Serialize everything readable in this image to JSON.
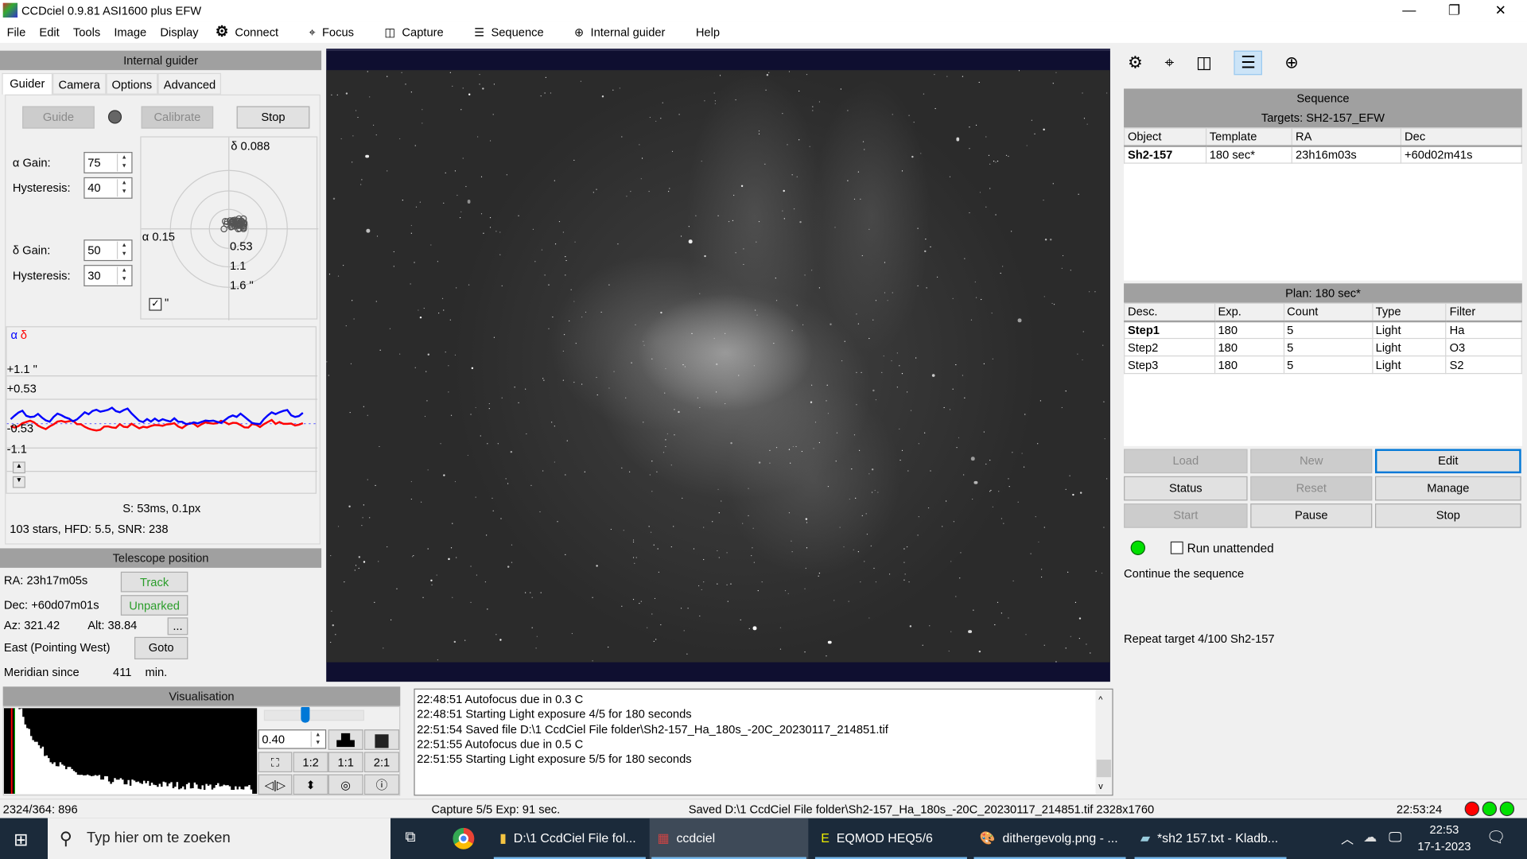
{
  "window": {
    "title": "CCDciel 0.9.81 ASI1600 plus EFW",
    "min": "—",
    "max": "❐",
    "close": "✕"
  },
  "menu": {
    "items": [
      "File",
      "Edit",
      "Tools",
      "Image",
      "Display"
    ],
    "tools": [
      {
        "label": "Connect",
        "icon": "gear-icon"
      },
      {
        "label": "Focus",
        "icon": "focus-icon"
      },
      {
        "label": "Capture",
        "icon": "camera-icon"
      },
      {
        "label": "Sequence",
        "icon": "list-icon"
      },
      {
        "label": "Internal guider",
        "icon": "crosshair-icon"
      }
    ],
    "help": "Help"
  },
  "guider": {
    "title": "Internal guider",
    "tabs": [
      "Guider",
      "Camera",
      "Options",
      "Advanced"
    ],
    "guide": "Guide",
    "calibrate": "Calibrate",
    "stop": "Stop",
    "alpha_gain_label": "α Gain:",
    "alpha_gain": "75",
    "alpha_hyst_label": "Hysteresis:",
    "alpha_hyst": "40",
    "delta_gain_label": "δ Gain:",
    "delta_gain": "50",
    "delta_hyst_label": "Hysteresis:",
    "delta_hyst": "30",
    "target": {
      "delta": "δ  0.088",
      "alpha": "α  0.15",
      "r1": "0.53",
      "r2": "1.1",
      "r3": "1.6 \"",
      "arcsec_label": "\"",
      "arcsec_checked": true
    },
    "graph": {
      "legend_alpha": "α",
      "legend_delta": "δ",
      "ticks": [
        "+1.1 \"",
        "+0.53",
        "-0.53",
        "-1.1"
      ],
      "alpha_color": "#0000ff",
      "delta_color": "#ff0000"
    },
    "stats": "S: 53ms, 0.1px",
    "stars": "103 stars, HFD: 5.5, SNR: 238"
  },
  "telescope": {
    "title": "Telescope position",
    "ra": "RA:  23h17m05s",
    "dec": "Dec: +60d07m01s",
    "az": "Az:  321.42",
    "alt": "Alt:  38.84",
    "pier": "East (Pointing West)",
    "meridian_label": "Meridian since",
    "meridian": "411",
    "meridian_unit": "min.",
    "track": "Track",
    "unparked": "Unparked",
    "more": "...",
    "goto": "Goto"
  },
  "visualisation": {
    "title": "Visualisation",
    "gamma": "0.40",
    "slider_value": 0.4,
    "zoom_buttons": [
      "1:2",
      "1:1",
      "2:1"
    ]
  },
  "log": [
    "22:48:51 Autofocus due in  0.3 C",
    "22:48:51 Starting Light exposure 4/5 for 180 seconds",
    "22:51:54 Saved file D:\\1 CcdCiel File folder\\Sh2-157_Ha_180s_-20C_20230117_214851.tif",
    "22:51:55 Autofocus due in  0.5 C",
    "22:51:55 Starting Light exposure 5/5 for 180 seconds"
  ],
  "sequence": {
    "title": "Sequence",
    "targets": "Targets: SH2-157_EFW",
    "target_cols": [
      "Object",
      "Template",
      "RA",
      "Dec"
    ],
    "target_rows": [
      [
        "Sh2-157",
        "180 sec*",
        "23h16m03s",
        "+60d02m41s"
      ]
    ],
    "plan": "Plan: 180 sec*",
    "plan_cols": [
      "Desc.",
      "Exp.",
      "Count",
      "Type",
      "Filter"
    ],
    "plan_rows": [
      [
        "Step1",
        "180",
        "5",
        "Light",
        "Ha"
      ],
      [
        "Step2",
        "180",
        "5",
        "Light",
        "O3"
      ],
      [
        "Step3",
        "180",
        "5",
        "Light",
        "S2"
      ]
    ],
    "buttons": {
      "load": "Load",
      "new": "New",
      "edit": "Edit",
      "status": "Status",
      "reset": "Reset",
      "manage": "Manage",
      "start": "Start",
      "pause": "Pause",
      "stop": "Stop"
    },
    "run_unattended": "Run unattended",
    "status_msg": "Continue the sequence",
    "repeat": "Repeat target 4/100 Sh2-157"
  },
  "statusbar": {
    "pixel": "2324/364: 896",
    "capture": "Capture 5/5 Exp: 91 sec.",
    "saved": "Saved D:\\1 CcdCiel File folder\\Sh2-157_Ha_180s_-20C_20230117_214851.tif 2328x1760",
    "time": "22:53:24",
    "lights": [
      "#ff0000",
      "#00e000",
      "#00e000"
    ]
  },
  "taskbar": {
    "search": "Typ hier om te zoeken",
    "apps": [
      "D:\\1 CcdCiel File fol...",
      "ccdciel",
      "EQMOD HEQ5/6",
      "dithergevolg.png - ...",
      "*sh2 157.txt - Kladb..."
    ],
    "clock_time": "22:53",
    "clock_date": "17-1-2023"
  }
}
